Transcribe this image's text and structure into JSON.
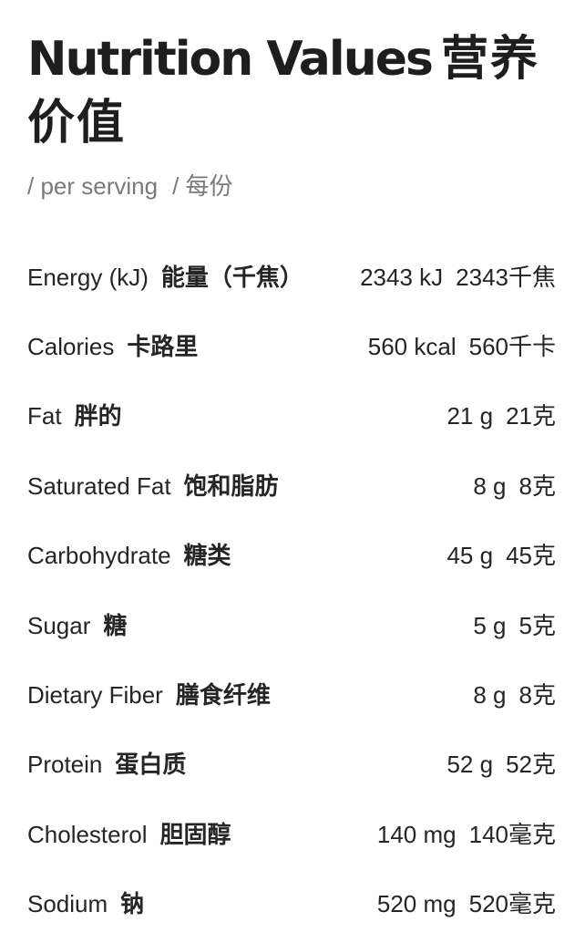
{
  "header": {
    "title_en": "Nutrition Values",
    "title_zh": "营养价值",
    "per_serving_en": "/ per serving",
    "per_serving_zh": "/ 每份"
  },
  "nutrients": [
    {
      "name_en": "Energy (kJ)",
      "name_zh": "能量（千焦）",
      "value_en": "2343 kJ",
      "value_zh": "2343千焦"
    },
    {
      "name_en": "Calories",
      "name_zh": "卡路里",
      "value_en": "560 kcal",
      "value_zh": "560千卡"
    },
    {
      "name_en": "Fat",
      "name_zh": "胖的",
      "value_en": "21 g",
      "value_zh": "21克"
    },
    {
      "name_en": "Saturated Fat",
      "name_zh": "饱和脂肪",
      "value_en": "8 g",
      "value_zh": "8克"
    },
    {
      "name_en": "Carbohydrate",
      "name_zh": "糖类",
      "value_en": "45 g",
      "value_zh": "45克"
    },
    {
      "name_en": "Sugar",
      "name_zh": "糖",
      "value_en": "5 g",
      "value_zh": "5克"
    },
    {
      "name_en": "Dietary Fiber",
      "name_zh": "膳食纤维",
      "value_en": "8 g",
      "value_zh": "8克"
    },
    {
      "name_en": "Protein",
      "name_zh": "蛋白质",
      "value_en": "52 g",
      "value_zh": "52克"
    },
    {
      "name_en": "Cholesterol",
      "name_zh": "胆固醇",
      "value_en": "140 mg",
      "value_zh": "140毫克"
    },
    {
      "name_en": "Sodium",
      "name_zh": "钠",
      "value_en": "520 mg",
      "value_zh": "520毫克"
    }
  ]
}
